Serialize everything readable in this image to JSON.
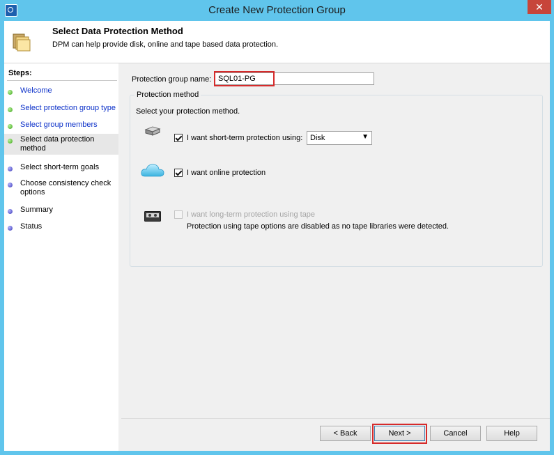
{
  "window": {
    "title": "Create New Protection Group",
    "close_glyph": "✕"
  },
  "header": {
    "title": "Select Data Protection Method",
    "subtitle": "DPM can help provide disk, online and tape based data protection.",
    "icon": "folders-icon"
  },
  "steps": {
    "heading": "Steps:",
    "items": [
      {
        "label": "Welcome",
        "status": "done"
      },
      {
        "label": "Select protection group type",
        "status": "done"
      },
      {
        "label": "Select group members",
        "status": "done"
      },
      {
        "label": "Select data protection method",
        "status": "current"
      },
      {
        "label": "Select short-term goals",
        "status": "pending"
      },
      {
        "label": "Choose consistency check options",
        "status": "pending"
      },
      {
        "label": "Summary",
        "status": "pending"
      },
      {
        "label": "Status",
        "status": "pending"
      }
    ]
  },
  "form": {
    "name_label": "Protection group name:",
    "name_value": "SQL01-PG",
    "group_title": "Protection method",
    "group_desc": "Select your protection method.",
    "short_term": {
      "label": "I want short-term protection using:",
      "checked": true,
      "option": "Disk",
      "icon": "disk-icon"
    },
    "online": {
      "label": "I want online protection",
      "checked": true,
      "icon": "cloud-icon"
    },
    "tape": {
      "label": "I want long-term protection using tape",
      "checked": false,
      "enabled": false,
      "note": "Protection using tape options are disabled as no tape libraries were detected.",
      "icon": "tape-icon"
    }
  },
  "buttons": {
    "back": "< Back",
    "next": "Next >",
    "cancel": "Cancel",
    "help": "Help"
  },
  "colors": {
    "titlebar": "#60c5ec",
    "highlight": "#d62b2b",
    "link": "#0b30c9"
  }
}
